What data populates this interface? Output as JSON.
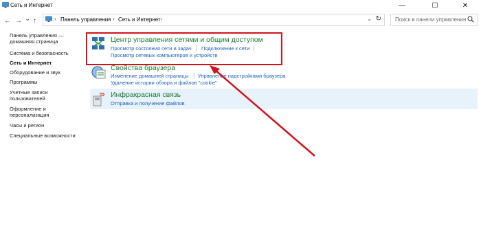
{
  "window": {
    "title": "Сеть и Интернет",
    "minimize": "—",
    "maximize": "☐",
    "close": "✕"
  },
  "nav": {
    "back": "←",
    "forward": "→",
    "recent": "⌄",
    "up": "↑",
    "breadcrumb": [
      "Панель управления",
      "Сеть и Интернет"
    ],
    "separator": "›",
    "dropdown": "⌄",
    "refresh": "↻",
    "search_placeholder": "Поиск в панели управления"
  },
  "sidebar": {
    "items": [
      {
        "label": "Панель управления — домашняя страница",
        "active": false
      },
      {
        "label": "Система и безопасность",
        "active": false
      },
      {
        "label": "Сеть и Интернет",
        "active": true
      },
      {
        "label": "Оборудование и звук",
        "active": false
      },
      {
        "label": "Программы",
        "active": false
      },
      {
        "label": "Учетные записи пользователей",
        "active": false
      },
      {
        "label": "Оформление и персонализация",
        "active": false
      },
      {
        "label": "Часы и регион",
        "active": false
      },
      {
        "label": "Специальные возможности",
        "active": false
      }
    ]
  },
  "categories": [
    {
      "title": "Центр управления сетями и общим доступом",
      "links": [
        "Просмотр состояния сети и задач",
        "Подключение к сети",
        "Просмотр сетевых компьютеров и устройств"
      ],
      "icon": "network-sharing-center-icon"
    },
    {
      "title": "Свойства браузера",
      "links": [
        "Изменение домашней страницы",
        "Управление надстройками браузера",
        "Удаление истории обзора и файлов \"cookie\""
      ],
      "icon": "internet-options-icon"
    },
    {
      "title": "Инфракрасная связь",
      "links": [
        "Отправка и получение файлов"
      ],
      "icon": "infrared-icon"
    }
  ],
  "annotation": {
    "highlight_color": "#d0121b"
  },
  "colors": {
    "category_title": "#1c7a34",
    "link": "#1a5fb4",
    "hover_row": "#e8f2fb"
  }
}
